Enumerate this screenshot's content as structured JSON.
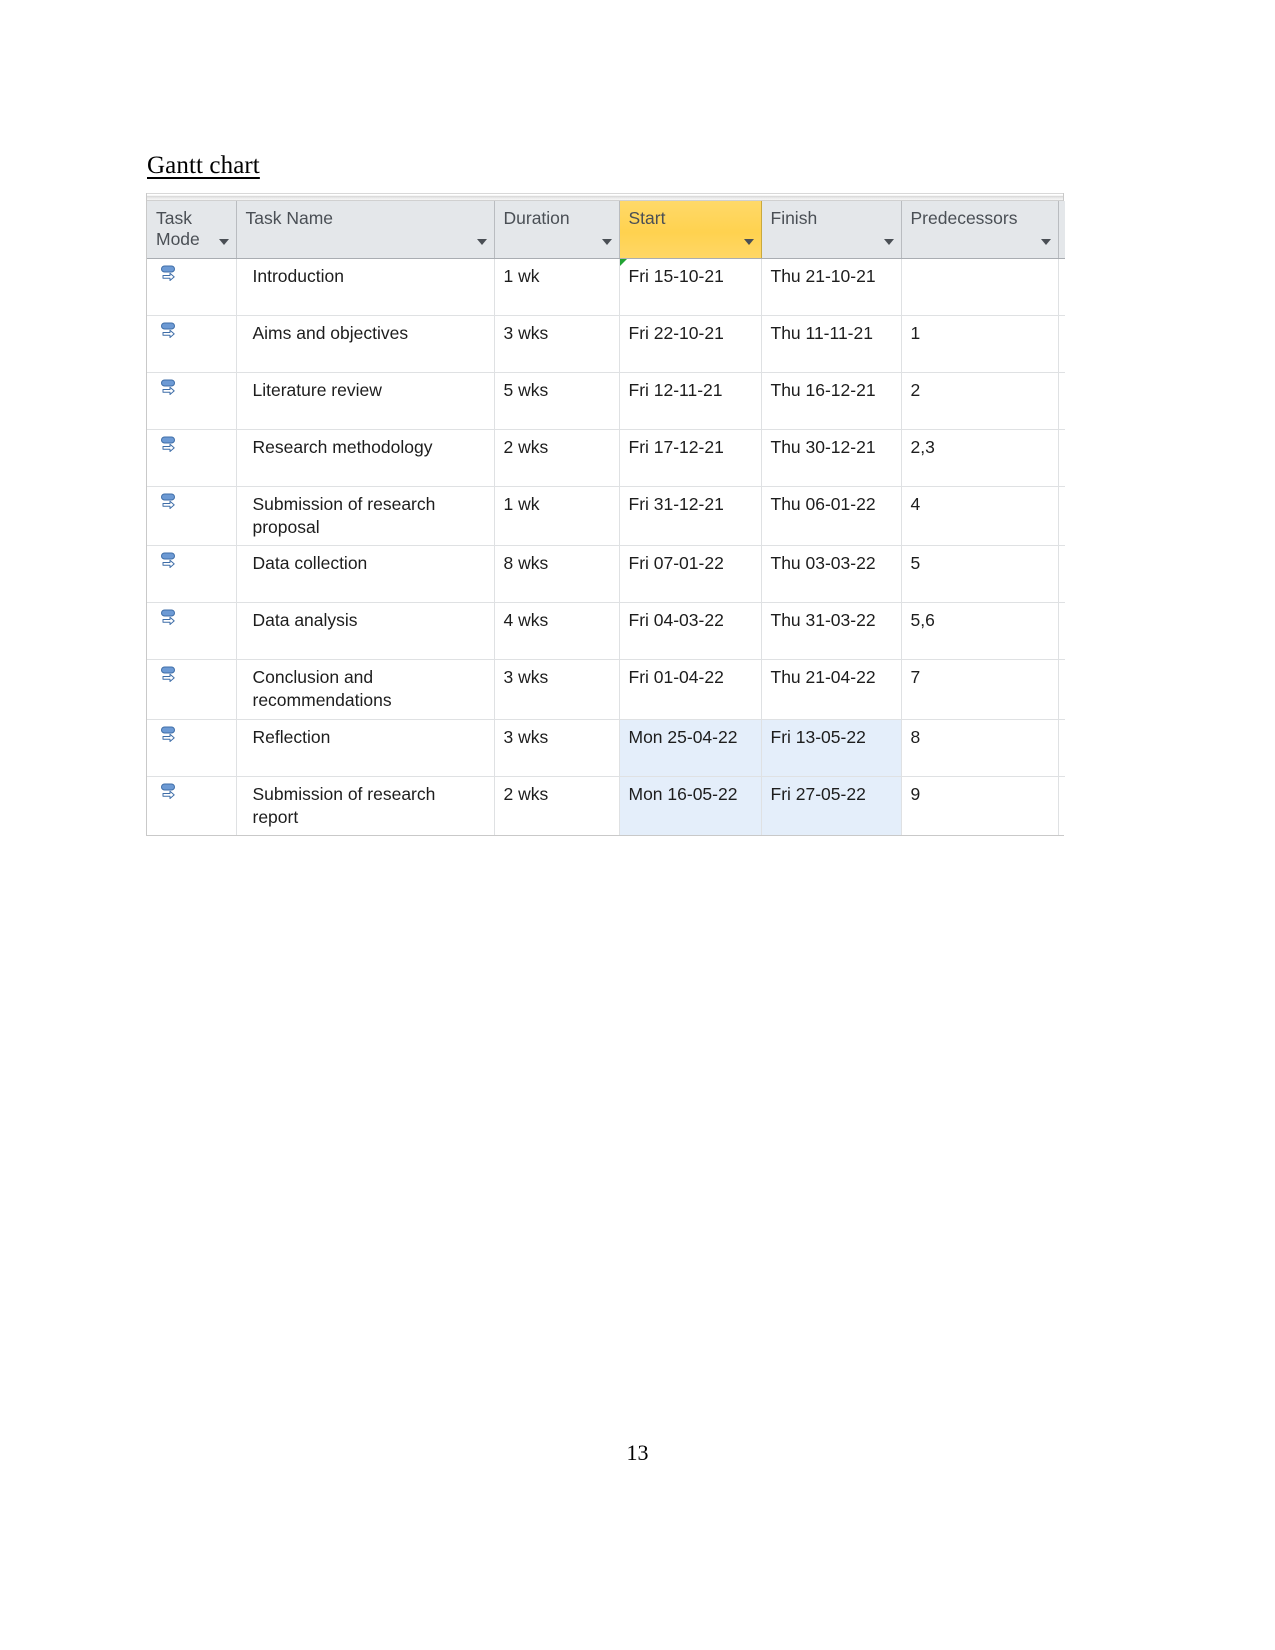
{
  "document": {
    "heading": "Gantt chart",
    "page_number": "13"
  },
  "colors": {
    "header_background": "#e4e7ea",
    "header_sorted_background": "#ffd24f",
    "selected_cell_background": "#e4eefa",
    "grid_line": "#dfe1e3",
    "text": "#1d1d1d",
    "header_text": "#4a4f55",
    "indicator_green": "#21a334",
    "task_mode_icon_blue": "#5b8fc9"
  },
  "table": {
    "name": "gantt-task-table",
    "columns": [
      {
        "key": "task_mode",
        "label": "Task\nMode",
        "has_filter_arrow": true,
        "sorted": false
      },
      {
        "key": "task_name",
        "label": "Task Name",
        "has_filter_arrow": true,
        "sorted": false
      },
      {
        "key": "duration",
        "label": "Duration",
        "has_filter_arrow": true,
        "sorted": false
      },
      {
        "key": "start",
        "label": "Start",
        "has_filter_arrow": true,
        "sorted": true
      },
      {
        "key": "finish",
        "label": "Finish",
        "has_filter_arrow": true,
        "sorted": false
      },
      {
        "key": "predecessors",
        "label": "Predecessors",
        "has_filter_arrow": true,
        "sorted": false
      },
      {
        "key": "truncated",
        "label": "",
        "has_filter_arrow": false,
        "sorted": false
      }
    ],
    "column_labels": {
      "task_mode_line1": "Task",
      "task_mode_line2": "Mode",
      "task_name": "Task Name",
      "duration": "Duration",
      "start": "Start",
      "finish": "Finish",
      "predecessors": "Predecessors"
    },
    "rows": [
      {
        "task_mode_icon": "auto-scheduled-icon",
        "task_name": "Introduction",
        "duration": "1 wk",
        "start": "Fri 15-10-21",
        "finish": "Thu 21-10-21",
        "predecessors": "",
        "selected": false,
        "has_green_indicator": true
      },
      {
        "task_mode_icon": "auto-scheduled-icon",
        "task_name": "Aims and objectives",
        "duration": "3 wks",
        "start": "Fri 22-10-21",
        "finish": "Thu 11-11-21",
        "predecessors": "1",
        "selected": false,
        "has_green_indicator": false
      },
      {
        "task_mode_icon": "auto-scheduled-icon",
        "task_name": "Literature review",
        "duration": "5 wks",
        "start": "Fri 12-11-21",
        "finish": "Thu 16-12-21",
        "predecessors": "2",
        "selected": false,
        "has_green_indicator": false
      },
      {
        "task_mode_icon": "auto-scheduled-icon",
        "task_name": "Research methodology",
        "duration": "2 wks",
        "start": "Fri 17-12-21",
        "finish": "Thu 30-12-21",
        "predecessors": "2,3",
        "selected": false,
        "has_green_indicator": false
      },
      {
        "task_mode_icon": "auto-scheduled-icon",
        "task_name": "Submission of research proposal",
        "duration": "1 wk",
        "start": "Fri 31-12-21",
        "finish": "Thu 06-01-22",
        "predecessors": "4",
        "selected": false,
        "has_green_indicator": false
      },
      {
        "task_mode_icon": "auto-scheduled-icon",
        "task_name": "Data collection",
        "duration": "8 wks",
        "start": "Fri 07-01-22",
        "finish": "Thu 03-03-22",
        "predecessors": "5",
        "selected": false,
        "has_green_indicator": false
      },
      {
        "task_mode_icon": "auto-scheduled-icon",
        "task_name": "Data analysis",
        "duration": "4 wks",
        "start": "Fri 04-03-22",
        "finish": "Thu 31-03-22",
        "predecessors": "5,6",
        "selected": false,
        "has_green_indicator": false
      },
      {
        "task_mode_icon": "auto-scheduled-icon",
        "task_name": "Conclusion and recommendations",
        "duration": "3 wks",
        "start": "Fri 01-04-22",
        "finish": "Thu 21-04-22",
        "predecessors": "7",
        "selected": false,
        "has_green_indicator": false
      },
      {
        "task_mode_icon": "auto-scheduled-icon",
        "task_name": "Reflection",
        "duration": "3 wks",
        "start": "Mon 25-04-22",
        "finish": "Fri 13-05-22",
        "predecessors": "8",
        "selected": true,
        "has_green_indicator": false
      },
      {
        "task_mode_icon": "auto-scheduled-icon",
        "task_name": "Submission of research report",
        "duration": "2 wks",
        "start": "Mon 16-05-22",
        "finish": "Fri 27-05-22",
        "predecessors": "9",
        "selected": true,
        "has_green_indicator": false
      }
    ]
  }
}
